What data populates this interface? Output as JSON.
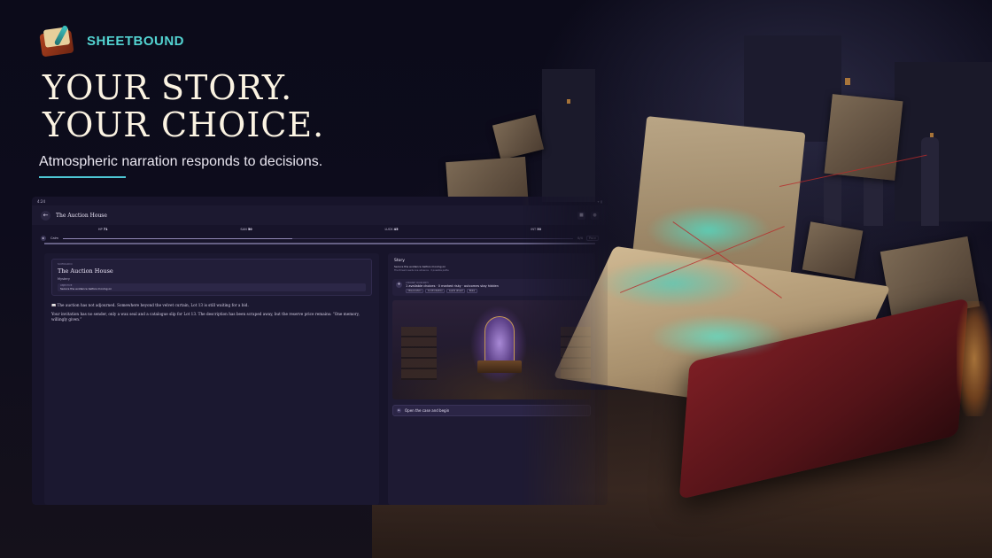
{
  "brand": {
    "name": "SHEETBOUND",
    "logo_icon": "book-quill-icon"
  },
  "hero": {
    "title_line1": "YOUR STORY.",
    "title_line2": "YOUR CHOICE.",
    "subtitle": "Atmospheric narration responds to decisions."
  },
  "colors": {
    "accent": "#53d3d1",
    "underline": "#4dc6d4",
    "title": "#fbf3e2",
    "app_bg": "#17142a"
  },
  "app": {
    "status_time": "4:24",
    "status_icons": "▾ ▮",
    "back_icon": "←",
    "title": "The Auction House",
    "appbar_icons": [
      "■",
      "●"
    ],
    "stats": [
      {
        "label": "HP",
        "value": "71"
      },
      {
        "label": "SAN",
        "value": "50"
      },
      {
        "label": "LUCK",
        "value": "45"
      },
      {
        "label": "INT",
        "value": "50"
      }
    ],
    "pace": {
      "icon": "▸",
      "label": "Calm",
      "progress": 0.45,
      "value": "0/4",
      "chip": "Pace"
    },
    "scenario": {
      "kicker": "SCENARIO",
      "title": "The Auction House",
      "genre": "Mystery",
      "objective_kicker": "OBJECTIVE",
      "objective": "Secure the evidence before moving on"
    },
    "narration": [
      "📖 The auction has not adjourned. Somewhere beyond the velvet curtain, Lot 13 is still waiting for a bid.",
      "Your invitation has no sender, only a wax seal and a catalogue slip for Lot 13. The description has been scraped away, but the reserve price remains: “One memory, willingly given.”"
    ],
    "story": {
      "title": "Story",
      "objective": "Secure the evidence before moving on",
      "hint": "The thread needs one advance · 3 possible paths"
    },
    "choices": {
      "kicker": "CHOOSE YOUR PATH",
      "summary": "1 available choices · 0 marked risky · outcomes stay hidden",
      "tags": [
        "Observation",
        "Confrontation",
        "Leads ahead",
        "Risks"
      ]
    },
    "action": {
      "icon": "▸",
      "label": "Open the case and begin"
    }
  }
}
